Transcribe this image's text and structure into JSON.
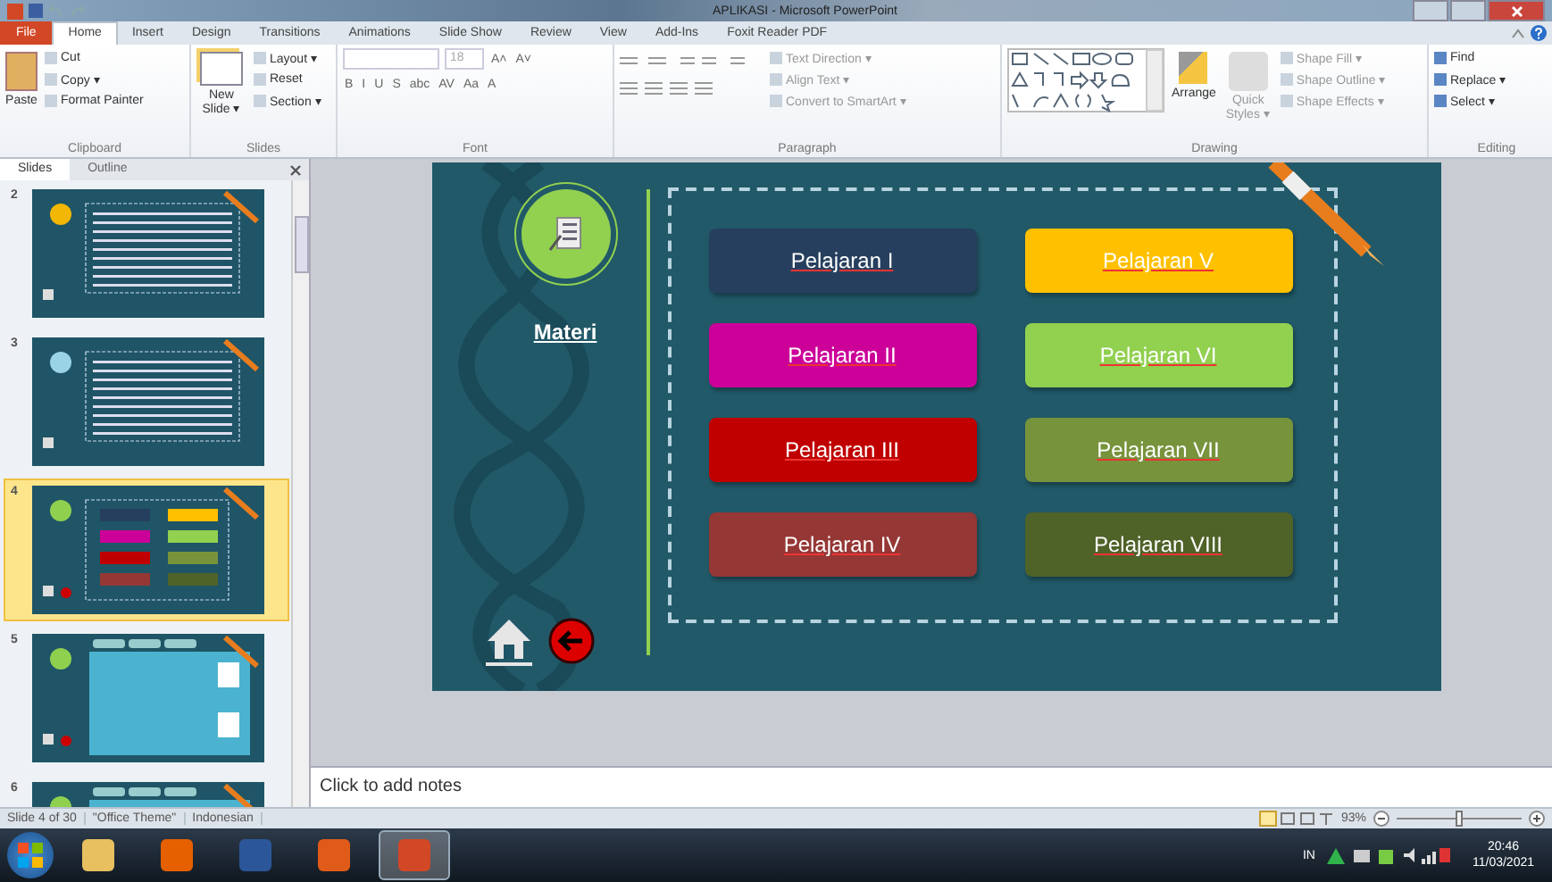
{
  "window": {
    "title": "APLIKASI - Microsoft PowerPoint"
  },
  "tabs": [
    {
      "label": "File",
      "kind": "file",
      "selected": false
    },
    {
      "label": "Home",
      "kind": "tab",
      "selected": true
    },
    {
      "label": "Insert",
      "kind": "tab",
      "selected": false
    },
    {
      "label": "Design",
      "kind": "tab",
      "selected": false
    },
    {
      "label": "Transitions",
      "kind": "tab",
      "selected": false
    },
    {
      "label": "Animations",
      "kind": "tab",
      "selected": false
    },
    {
      "label": "Slide Show",
      "kind": "tab",
      "selected": false
    },
    {
      "label": "Review",
      "kind": "tab",
      "selected": false
    },
    {
      "label": "View",
      "kind": "tab",
      "selected": false
    },
    {
      "label": "Add-Ins",
      "kind": "tab",
      "selected": false
    },
    {
      "label": "Foxit Reader PDF",
      "kind": "tab",
      "selected": false
    }
  ],
  "clipboard": {
    "name": "Clipboard",
    "paste": "Paste",
    "items": [
      "Cut",
      "Copy ▾",
      "Format Painter"
    ]
  },
  "slides_group": {
    "name": "Slides",
    "new_slide": "New Slide ▾",
    "items": [
      "Layout ▾",
      "Reset",
      "Section ▾"
    ]
  },
  "font": {
    "name": "Font",
    "size": "18",
    "row1": [
      "A˄",
      "A˅"
    ],
    "row2": [
      "B",
      "I",
      "U",
      "S",
      "abc",
      "AV",
      "Aa",
      "A"
    ]
  },
  "paragraph": {
    "name": "Paragraph",
    "items": [
      "Text Direction ▾",
      "Align Text ▾",
      "Convert to SmartArt ▾"
    ]
  },
  "drawing": {
    "name": "Drawing",
    "arrange": "Arrange",
    "quick_styles": "Quick Styles ▾",
    "items": [
      "Shape Fill ▾",
      "Shape Outline ▾",
      "Shape Effects ▾"
    ]
  },
  "editing": {
    "name": "Editing",
    "items": [
      "Find",
      "Replace ▾",
      "Select ▾"
    ]
  },
  "panel": {
    "tabs": [
      {
        "label": "Slides",
        "selected": true
      },
      {
        "label": "Outline",
        "selected": false
      }
    ],
    "slides": [
      {
        "number": "2",
        "kind": "text",
        "selected": false
      },
      {
        "number": "3",
        "kind": "text",
        "selected": false
      },
      {
        "number": "4",
        "kind": "menu",
        "selected": true
      },
      {
        "number": "5",
        "kind": "tabs",
        "selected": false
      },
      {
        "number": "6",
        "kind": "tabs",
        "selected": false
      }
    ]
  },
  "slide": {
    "heading": "Materi",
    "lessons": [
      {
        "label": "Pelajaran I",
        "color": "#263f5e"
      },
      {
        "label": "Pelajaran V",
        "color": "#ffc000"
      },
      {
        "label": "Pelajaran II",
        "color": "#cc0099"
      },
      {
        "label": "Pelajaran VI",
        "color": "#92d050"
      },
      {
        "label": "Pelajaran III",
        "color": "#c00000"
      },
      {
        "label": "Pelajaran VII",
        "color": "#77933c"
      },
      {
        "label": "Pelajaran IV",
        "color": "#953735"
      },
      {
        "label": "Pelajaran VIII",
        "color": "#4f6228"
      }
    ]
  },
  "notes": {
    "placeholder": "Click to add notes"
  },
  "status": {
    "items": [
      "Slide 4 of 30",
      "\"Office Theme\"",
      "Indonesian"
    ],
    "zoom": "93%",
    "level": 0.5
  },
  "taskbar": {
    "apps": [
      {
        "kind": "folder",
        "selected": false
      },
      {
        "kind": "firefox",
        "selected": false
      },
      {
        "kind": "word",
        "selected": false
      },
      {
        "kind": "foxit",
        "selected": false
      },
      {
        "kind": "powerpoint",
        "selected": true
      }
    ],
    "language": "IN",
    "time": "20:46",
    "date": "11/03/2021"
  }
}
